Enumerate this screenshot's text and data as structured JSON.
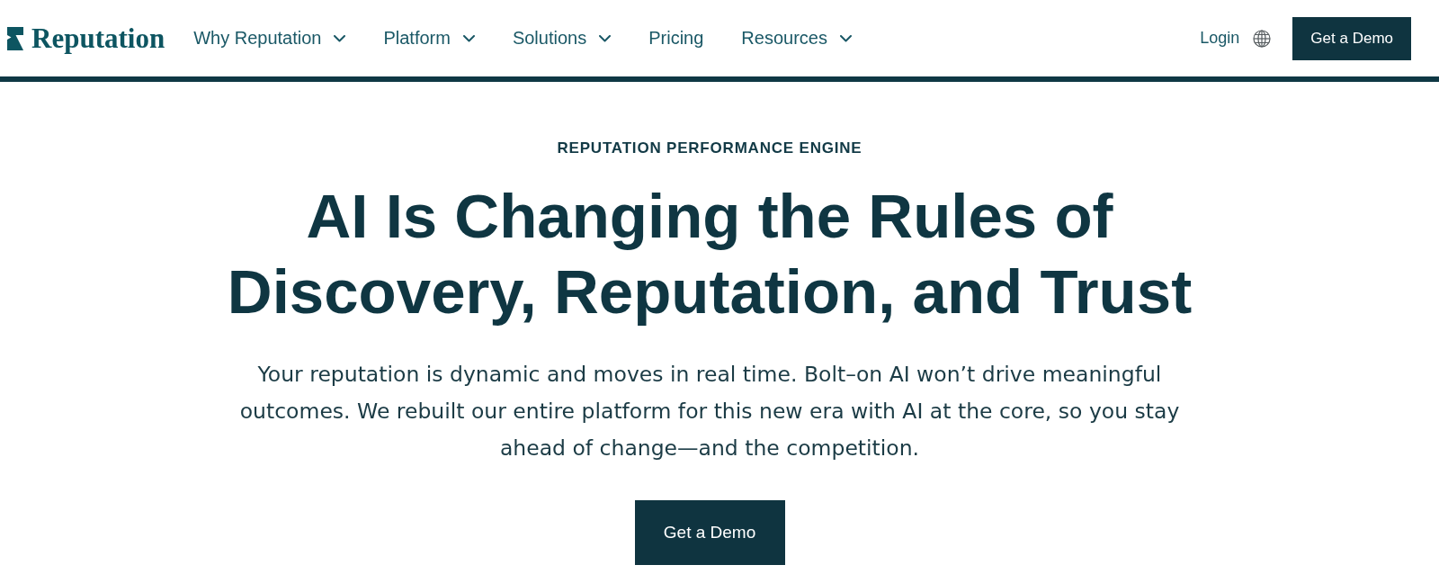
{
  "header": {
    "logo": {
      "text": "Reputation"
    },
    "nav": [
      {
        "label": "Why Reputation",
        "dropdown": true
      },
      {
        "label": "Platform",
        "dropdown": true
      },
      {
        "label": "Solutions",
        "dropdown": true
      },
      {
        "label": "Pricing",
        "dropdown": false
      },
      {
        "label": "Resources",
        "dropdown": true
      }
    ],
    "login": "Login",
    "cta": "Get a Demo"
  },
  "hero": {
    "eyebrow": "REPUTATION PERFORMANCE ENGINE",
    "title": "AI Is Changing the Rules of Discovery, Reputation, and Trust",
    "description": "Your reputation is dynamic and moves in real time. Bolt–on AI won’t drive meaningful outcomes. We rebuilt our entire platform for this new era with AI at the core, so you stay ahead of change—and the competition.",
    "cta": "Get a Demo"
  }
}
